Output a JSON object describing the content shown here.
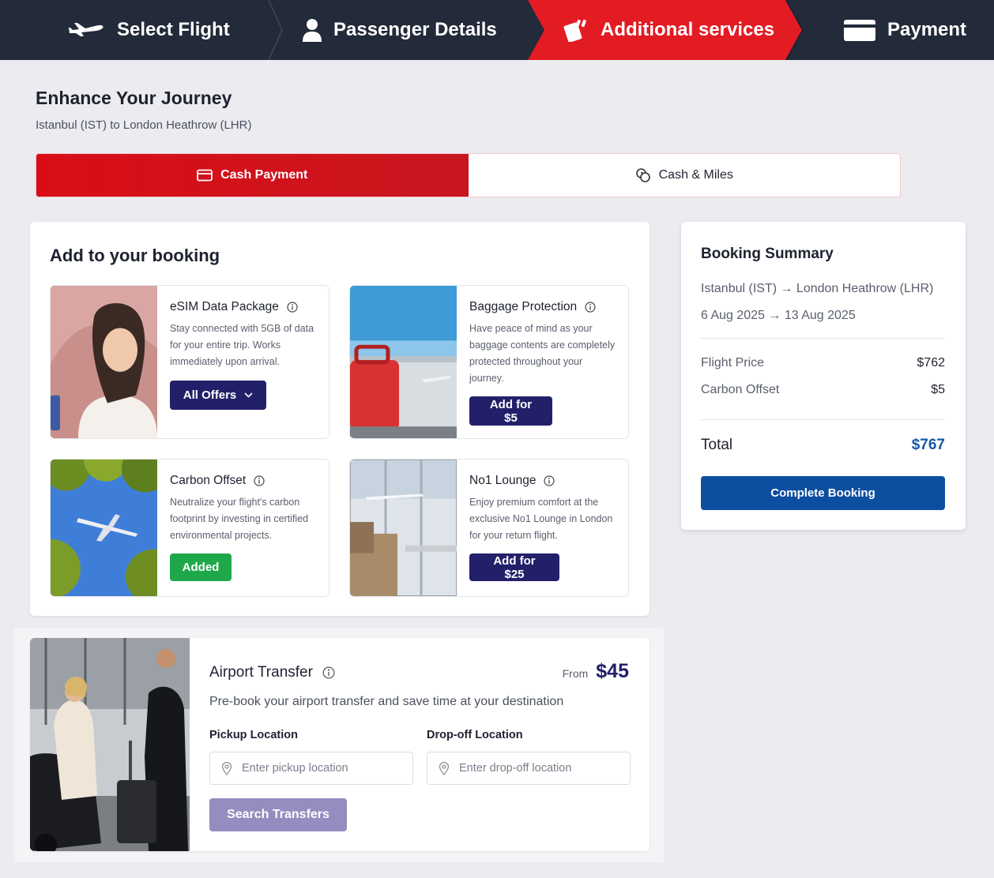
{
  "stepper": {
    "steps": [
      {
        "label": "Select Flight",
        "icon": "airplane-icon",
        "state": "done"
      },
      {
        "label": "Passenger Details",
        "icon": "user-icon",
        "state": "done"
      },
      {
        "label": "Additional services",
        "icon": "tickets-icon",
        "state": "active"
      },
      {
        "label": "Payment",
        "icon": "card-icon",
        "state": "upcoming"
      }
    ]
  },
  "header": {
    "title": "Enhance Your Journey",
    "subtitle": "Istanbul (IST) to London Heathrow (LHR)"
  },
  "payment_toggle": {
    "options": [
      {
        "label": "Cash Payment",
        "icon": "card-icon",
        "selected": true
      },
      {
        "label": "Cash & Miles",
        "icon": "coins-icon",
        "selected": false
      }
    ]
  },
  "booking": {
    "title": "Add to your booking",
    "cards": [
      {
        "title": "eSIM Data Package",
        "description": "Stay connected with 5GB of data for your entire trip. Works immediately upon arrival.",
        "button": "All Offers",
        "button_style": "dropdown"
      },
      {
        "title": "Baggage Protection",
        "description": "Have peace of mind as your baggage contents are completely protected throughout your journey.",
        "button": "Add for $5",
        "button_style": "add"
      },
      {
        "title": "Carbon Offset",
        "description": "Neutralize your flight's carbon footprint by investing in certified environmental projects.",
        "button": "Added",
        "button_style": "added"
      },
      {
        "title": "No1 Lounge",
        "description": "Enjoy premium comfort at the exclusive No1 Lounge in London for your return flight.",
        "button": "Add for $25",
        "button_style": "add"
      }
    ]
  },
  "summary": {
    "title": "Booking Summary",
    "route": "Istanbul (IST) → London Heathrow (LHR)",
    "dates": "6 Aug 2025 → 13 Aug 2025",
    "lines": [
      {
        "label": "Flight Price",
        "value": "$762"
      },
      {
        "label": "Carbon Offset",
        "value": "$5"
      }
    ],
    "total_label": "Total",
    "total_value": "$767",
    "cta": "Complete Booking"
  },
  "transfer": {
    "title": "Airport Transfer",
    "from_label": "From",
    "price": "$45",
    "description": "Pre-book your airport transfer and save time at your destination",
    "pickup_label": "Pickup Location",
    "pickup_placeholder": "Enter pickup location",
    "dropoff_label": "Drop-off Location",
    "dropoff_placeholder": "Enter drop-off location",
    "search_button": "Search Transfers"
  },
  "colors": {
    "nav_bg": "#232a3a",
    "active_red": "#e31b23",
    "navy_button": "#23206a",
    "added_green": "#1fa84a",
    "total_blue": "#1857a8",
    "cta_blue": "#0c4ea0",
    "search_disabled": "#968cc0"
  }
}
